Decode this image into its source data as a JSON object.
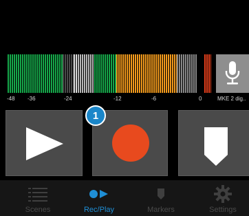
{
  "level_meter": {
    "scale_labels": [
      "-48",
      "-36",
      "-24",
      "-12",
      "-6",
      "0"
    ]
  },
  "input_device": {
    "label": "MKE 2 dig..",
    "icon": "microphone-icon"
  },
  "transport": {
    "play": {
      "icon": "play-icon"
    },
    "record": {
      "icon": "record-icon",
      "color": "#e84a1e"
    },
    "marker": {
      "icon": "marker-icon"
    }
  },
  "badge": {
    "text": "1",
    "color": "#1a86c9"
  },
  "tabs": [
    {
      "label": "Scenes",
      "icon": "list-icon",
      "active": false
    },
    {
      "label": "Rec/Play",
      "icon": "rec-play-icon",
      "active": true
    },
    {
      "label": "Markers",
      "icon": "marker-icon",
      "active": false
    },
    {
      "label": "Settings",
      "icon": "gear-icon",
      "active": false
    }
  ],
  "colors": {
    "accent": "#1f8fd6",
    "meter_green": "#16a84a",
    "meter_orange": "#f29a1c",
    "meter_red": "#e8401c"
  }
}
